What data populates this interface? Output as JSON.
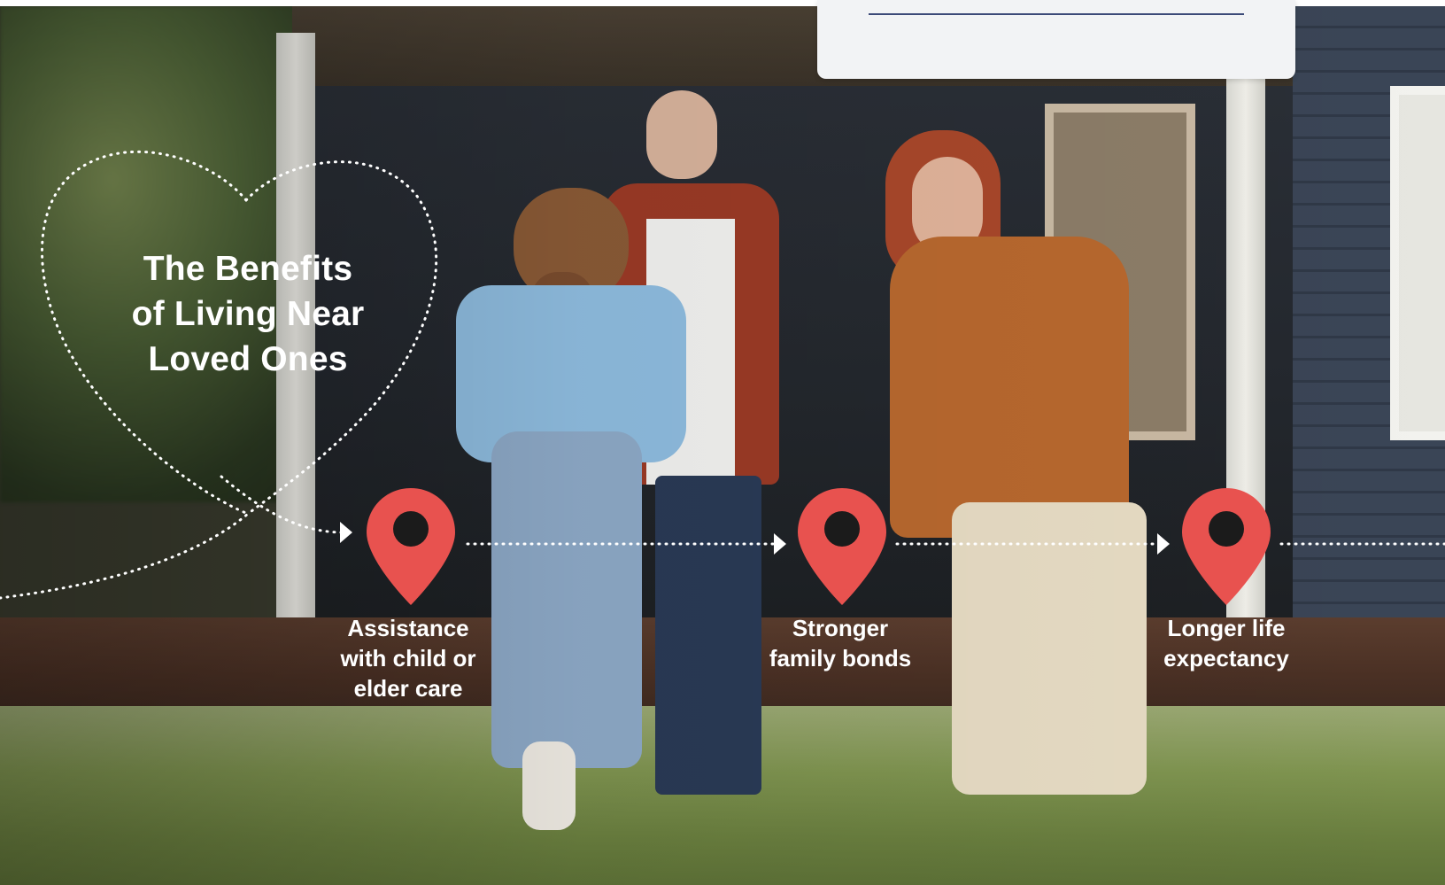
{
  "headline": {
    "lines": [
      "The Benefits",
      "of Living Near",
      "Loved Ones"
    ]
  },
  "benefits": [
    {
      "lines": [
        "Assistance",
        "with child or",
        "elder care"
      ],
      "icon": "location-pin-icon"
    },
    {
      "lines": [
        "Stronger",
        "family bonds"
      ],
      "icon": "location-pin-icon"
    },
    {
      "lines": [
        "Longer life",
        "expectancy"
      ],
      "icon": "location-pin-icon"
    }
  ],
  "colors": {
    "pin": "#e8524f",
    "pin_hole": "#1b1b1b",
    "text": "#ffffff",
    "card": "#f2f3f5",
    "card_rule": "#3c4a78"
  },
  "decorations": {
    "heart": "heart-outline-icon",
    "path": "dotted-path-arrows"
  }
}
